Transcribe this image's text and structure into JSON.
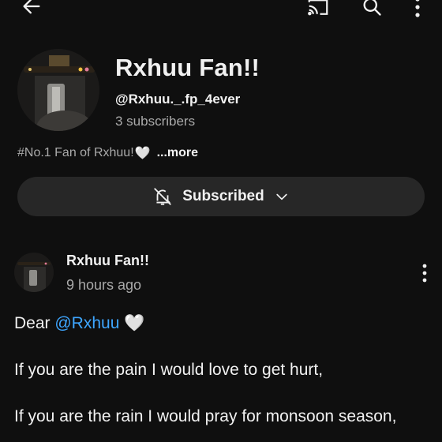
{
  "topbar": {
    "back_icon": "arrow-left-icon",
    "cast_icon": "cast-icon",
    "search_icon": "search-icon",
    "more_icon": "more-vertical-icon"
  },
  "channel": {
    "name": "Rxhuu Fan!!",
    "handle": "@Rxhuu._.fp_4ever",
    "subscribers": "3 subscribers",
    "description": "#No.1  Fan  of Rxhuu!",
    "description_heart": "🤍",
    "more_label": "...more",
    "subscribe_button": "Subscribed",
    "bell_icon": "bell-off-icon",
    "chevron_icon": "chevron-down-icon"
  },
  "post": {
    "author": "Rxhuu Fan!!",
    "time": "9 hours ago",
    "greeting": "Dear ",
    "mention": "@Rxhuu",
    "heart": "🤍",
    "lines": [
      "If you are the pain I would love to get hurt,",
      "If you are the rain I would pray for monsoon season,"
    ]
  },
  "colors": {
    "background": "#0f0f0f",
    "button_bg": "#272727",
    "secondary_text": "#aaaaaa",
    "link": "#3ea6ff"
  }
}
